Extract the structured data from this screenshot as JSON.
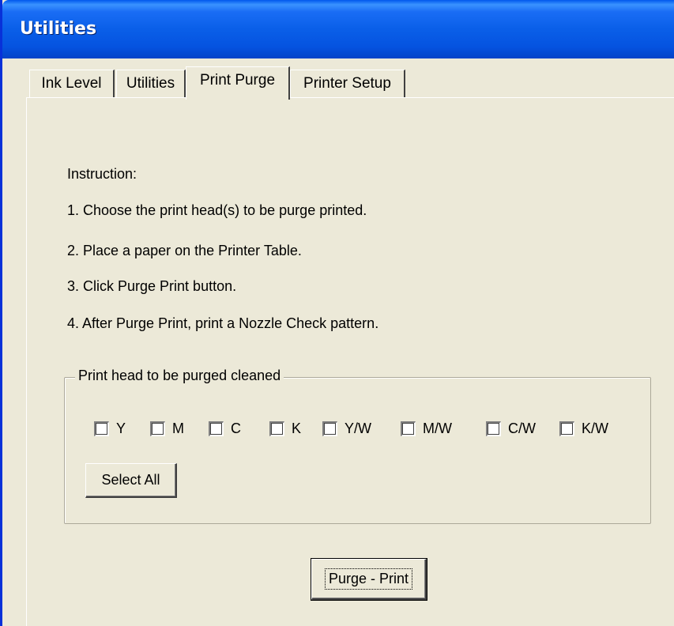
{
  "window": {
    "title": "Utilities"
  },
  "tabs": [
    {
      "label": "Ink Level"
    },
    {
      "label": "Utilities"
    },
    {
      "label": "Print Purge"
    },
    {
      "label": "Printer Setup"
    }
  ],
  "active_tab": "Print Purge",
  "instructions": {
    "heading": "Instruction:",
    "steps": [
      "1. Choose the print head(s) to be purge printed.",
      "2. Place a paper on the Printer Table.",
      "3. Click Purge Print button.",
      "4. After Purge Print, print a Nozzle Check pattern."
    ]
  },
  "print_heads": {
    "legend": "Print head to be purged cleaned",
    "options": [
      {
        "label": "Y",
        "checked": false
      },
      {
        "label": "M",
        "checked": false
      },
      {
        "label": "C",
        "checked": false
      },
      {
        "label": "K",
        "checked": false
      },
      {
        "label": "Y/W",
        "checked": false
      },
      {
        "label": "M/W",
        "checked": false
      },
      {
        "label": "C/W",
        "checked": false
      },
      {
        "label": "K/W",
        "checked": false
      }
    ],
    "select_all_label": "Select All"
  },
  "purge_print_label": "Purge - Print"
}
